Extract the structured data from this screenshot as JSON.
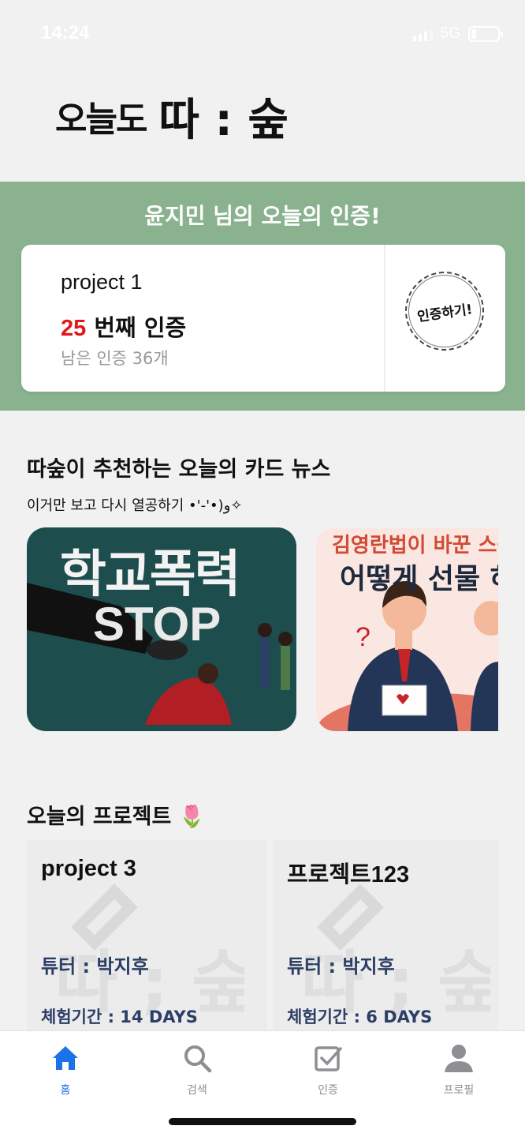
{
  "status_bar": {
    "time": "14:24",
    "network": "5G"
  },
  "logo": {
    "part1": "오늘도",
    "part2": "따 : 숲"
  },
  "certification": {
    "title": "윤지민 님의 오늘의 인증!",
    "project": "project 1",
    "count_number": "25",
    "count_suffix": " 번째 인증",
    "remaining": "남은 인증 36개",
    "button_label": "인증하기!"
  },
  "card_news": {
    "title": "따숲이 추천하는 오늘의 카드 뉴스",
    "subtitle": "이거만 보고 다시 열공하기 •'-'•)و✧",
    "cards": [
      {
        "line1": "학교폭력",
        "line2": "STOP"
      },
      {
        "line1": "김영란법이 바꾼 스승",
        "line2": "어떻게 선물 하"
      }
    ]
  },
  "projects": {
    "title": "오늘의 프로젝트 🌷",
    "items": [
      {
        "name": "project 3",
        "tutor": "튜터 : 박지후",
        "period": "체험기간 : 14 DAYS"
      },
      {
        "name": "프로젝트123",
        "tutor": "튜터 : 박지후",
        "period": "체험기간 : 6 DAYS"
      }
    ]
  },
  "tabbar": {
    "items": [
      {
        "label": "홈",
        "icon": "home-icon"
      },
      {
        "label": "검색",
        "icon": "search-icon"
      },
      {
        "label": "인증",
        "icon": "checkbox-icon"
      },
      {
        "label": "프로필",
        "icon": "profile-icon"
      }
    ]
  },
  "colors": {
    "banner": "#8ab28f",
    "accent": "#1a73e8",
    "count": "#e01818",
    "tutor_text": "#2c3e66"
  }
}
